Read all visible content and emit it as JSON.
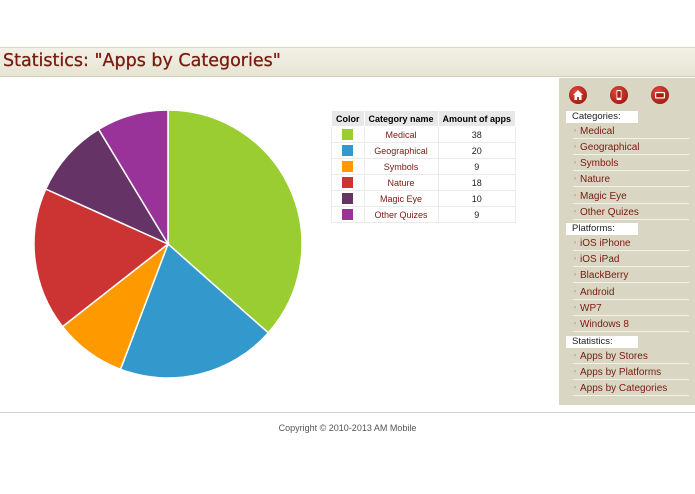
{
  "page": {
    "title": "Statistics: \"Apps by Categories\""
  },
  "legend_table": {
    "headers": [
      "Color",
      "Category name",
      "Amount of apps"
    ]
  },
  "chart_data": {
    "type": "pie",
    "categories": [
      "Medical",
      "Geographical",
      "Symbols",
      "Nature",
      "Magic Eye",
      "Other Quizes"
    ],
    "values": [
      38,
      20,
      9,
      18,
      10,
      9
    ],
    "colors": [
      "#9acd32",
      "#3399cc",
      "#ff9900",
      "#cc3333",
      "#663366",
      "#993399"
    ]
  },
  "sidebar": {
    "icons": [
      "home-icon",
      "phone-icon",
      "tv-icon"
    ],
    "sections": [
      {
        "title": "Categories:",
        "items": [
          "Medical",
          "Geographical",
          "Symbols",
          "Nature",
          "Magic Eye",
          "Other Quizes"
        ]
      },
      {
        "title": "Platforms:",
        "items": [
          "iOS iPhone",
          "iOS iPad",
          "BlackBerry",
          "Android",
          "WP7",
          "Windows 8"
        ]
      },
      {
        "title": "Statistics:",
        "items": [
          "Apps by Stores",
          "Apps by Platforms",
          "Apps by Categories"
        ]
      }
    ]
  },
  "footer": {
    "copyright": "Copyright © 2010-2013 AM Mobile"
  }
}
